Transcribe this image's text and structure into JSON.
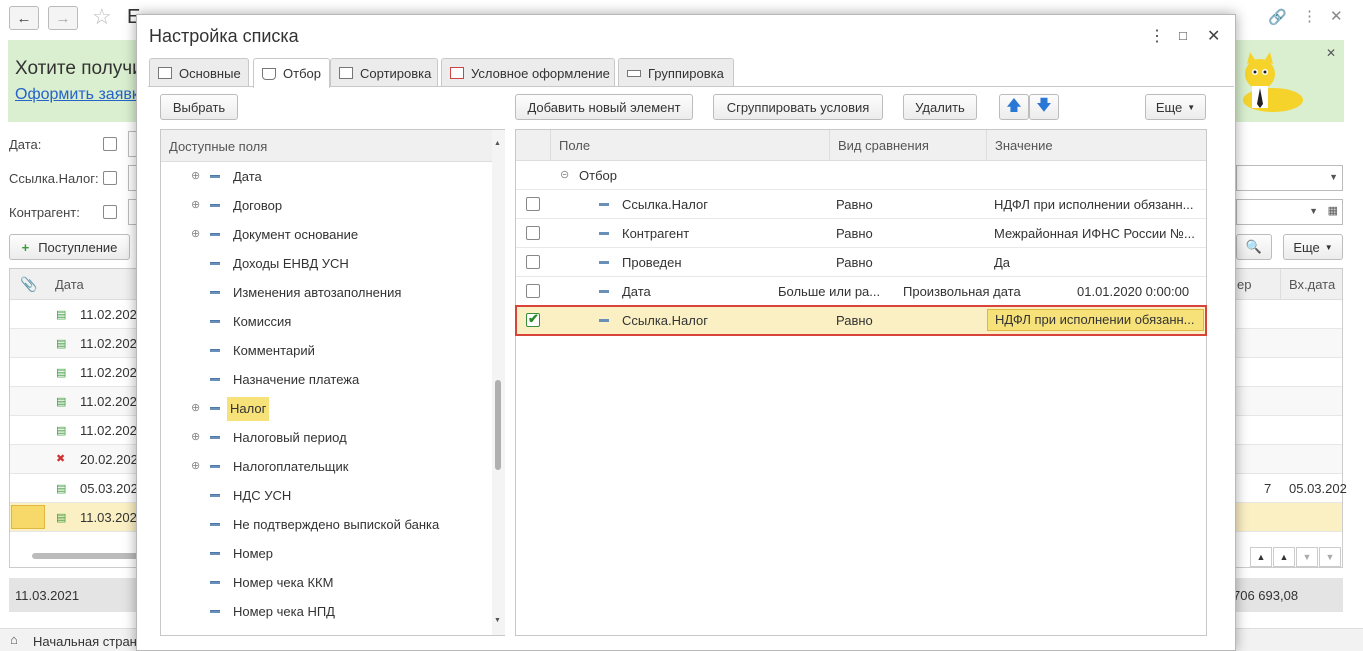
{
  "background": {
    "title_partial": "Е",
    "banner": {
      "title": "Хотите получи",
      "link": "Оформить заявк"
    },
    "filters": [
      {
        "label": "Дата:"
      },
      {
        "label": "Ссылка.Налог:"
      },
      {
        "label": "Контрагент:"
      }
    ],
    "add_button": "Поступление",
    "more_button": "Еще",
    "columns": {
      "date": "Дата",
      "num_partial": "ер",
      "in_date": "Вх.дата"
    },
    "rows": [
      "11.02.202",
      "11.02.202",
      "11.02.202",
      "11.02.202",
      "11.02.202",
      "20.02.202",
      "05.03.202",
      "11.03.202"
    ],
    "row7_tail": {
      "num": "7",
      "in_date": "05.03.202"
    },
    "status_date": "11.03.2021",
    "status_sum": "706 693,08",
    "taskbar_label": "Начальная стран"
  },
  "dialog": {
    "title": "Настройка списка",
    "tabs": [
      "Основные",
      "Отбор",
      "Сортировка",
      "Условное оформление",
      "Группировка"
    ],
    "active_tab": 1,
    "left": {
      "select_button": "Выбрать",
      "header": "Доступные поля",
      "items": [
        {
          "label": "Дата",
          "expandable": true
        },
        {
          "label": "Договор",
          "expandable": true
        },
        {
          "label": "Документ основание",
          "expandable": true
        },
        {
          "label": "Доходы ЕНВД УСН",
          "expandable": false
        },
        {
          "label": "Изменения автозаполнения",
          "expandable": false
        },
        {
          "label": "Комиссия",
          "expandable": false
        },
        {
          "label": "Комментарий",
          "expandable": false
        },
        {
          "label": "Назначение платежа",
          "expandable": false
        },
        {
          "label": "Налог",
          "expandable": true,
          "selected": true
        },
        {
          "label": "Налоговый период",
          "expandable": true
        },
        {
          "label": "Налогоплательщик",
          "expandable": true
        },
        {
          "label": "НДС УСН",
          "expandable": false
        },
        {
          "label": "Не подтверждено выпиской банка",
          "expandable": false
        },
        {
          "label": "Номер",
          "expandable": false
        },
        {
          "label": "Номер чека ККМ",
          "expandable": false
        },
        {
          "label": "Номер чека НПД",
          "expandable": false
        }
      ]
    },
    "toolbar": {
      "add": "Добавить новый элемент",
      "group": "Сгруппировать условия",
      "delete": "Удалить",
      "more": "Еще"
    },
    "right": {
      "columns": {
        "field": "Поле",
        "compare": "Вид сравнения",
        "value": "Значение"
      },
      "group_label": "Отбор",
      "rows": [
        {
          "field": "Ссылка.Налог",
          "compare": "Равно",
          "value": "НДФЛ при исполнении обязанн...",
          "checked": false
        },
        {
          "field": "Контрагент",
          "compare": "Равно",
          "value": "Межрайонная ИФНС России №...",
          "checked": false
        },
        {
          "field": "Проведен",
          "compare": "Равно",
          "value": "Да",
          "checked": false
        },
        {
          "field": "Дата",
          "compare": "Больше или ра...",
          "value_kind": "Произвольная дата",
          "value": "01.01.2020 0:00:00",
          "checked": false
        },
        {
          "field": "Ссылка.Налог",
          "compare": "Равно",
          "value": "НДФЛ при исполнении обязанн...",
          "checked": true,
          "selected": true
        }
      ]
    }
  }
}
